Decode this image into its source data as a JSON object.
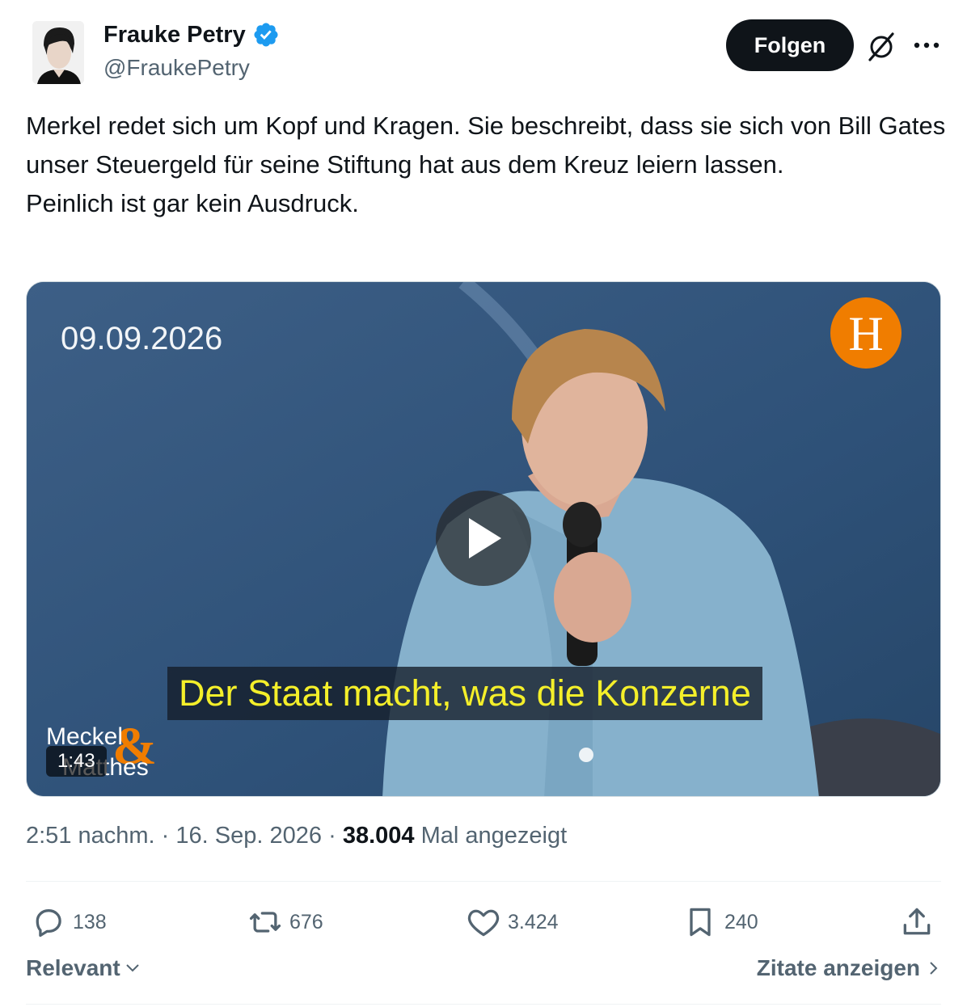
{
  "author": {
    "name": "Frauke Petry",
    "handle": "@FraukePetry",
    "verified": true
  },
  "header": {
    "follow_label": "Folgen",
    "grok_icon": "grok-icon",
    "more_icon": "more-dots-icon"
  },
  "tweet": {
    "lines": [
      "Merkel redet sich um Kopf und Kragen. Sie beschreibt, dass sie sich von Bill Gates unser Steuergeld für seine Stiftung hat aus dem Kreuz leiern lassen.",
      "Peinlich ist gar kein Ausdruck."
    ]
  },
  "media": {
    "date_overlay": "09.09.2026",
    "subtitle": "Der Staat macht, was die Konzerne",
    "duration": "1:43",
    "logo_letter": "H",
    "brand_text_top": "Meckel",
    "brand_text_bottom": "Matthes",
    "brand_ampersand": "&"
  },
  "meta": {
    "time": "2:51 nachm.",
    "separator": "·",
    "date": "16. Sep. 2026",
    "views_count": "38.004",
    "views_label": "Mal angezeigt"
  },
  "actions": {
    "replies": "138",
    "reposts": "676",
    "likes": "3.424",
    "bookmarks": "240"
  },
  "footer": {
    "sort_label": "Relevant",
    "quotes_label": "Zitate anzeigen"
  },
  "colors": {
    "text": "#0f1419",
    "secondary": "#536471",
    "verified": "#1d9bf0",
    "subtitle": "#f4ef2a",
    "logo_orange": "#f07d00"
  }
}
